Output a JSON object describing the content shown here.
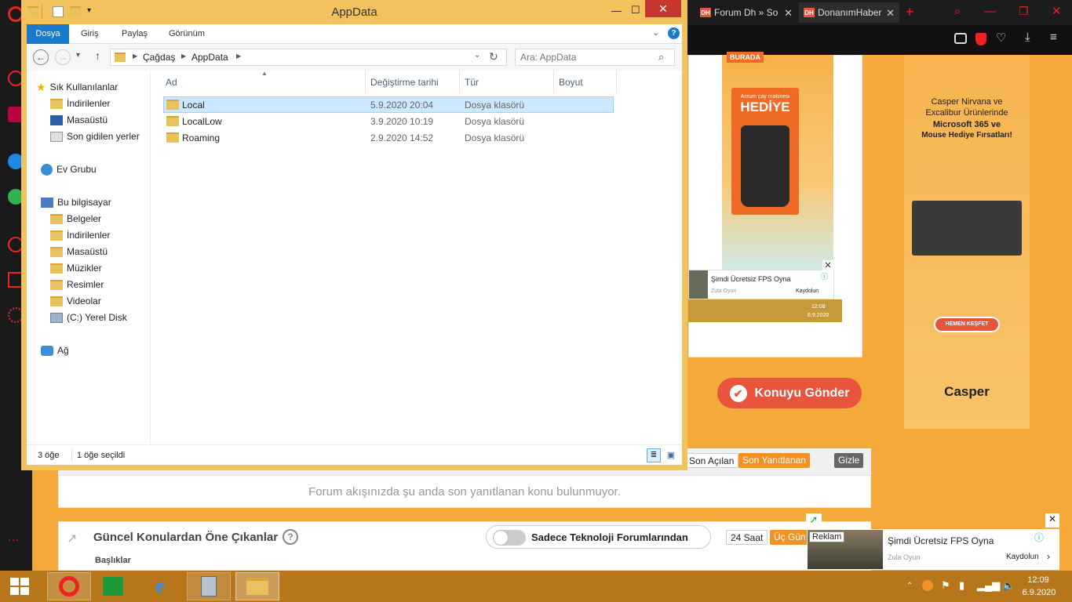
{
  "explorer": {
    "title": "AppData",
    "ribbon_tabs": [
      "Dosya",
      "Giriş",
      "Paylaş",
      "Görünüm"
    ],
    "breadcrumb": [
      "Çağdaş",
      "AppData"
    ],
    "search_placeholder": "Ara: AppData",
    "nav": {
      "favorites": {
        "label": "Sık Kullanılanlar",
        "items": [
          "İndirilenler",
          "Masaüstü",
          "Son gidilen yerler"
        ]
      },
      "homegroup": "Ev Grubu",
      "computer": {
        "label": "Bu bilgisayar",
        "items": [
          "Belgeler",
          "İndirilenler",
          "Masaüstü",
          "Müzikler",
          "Resimler",
          "Videolar",
          "(C:) Yerel Disk"
        ]
      },
      "network": "Ağ"
    },
    "columns": [
      "Ad",
      "Değiştirme tarihi",
      "Tür",
      "Boyut"
    ],
    "files": [
      {
        "name": "Local",
        "date": "5.9.2020 20:04",
        "type": "Dosya klasörü",
        "size": ""
      },
      {
        "name": "LocalLow",
        "date": "3.9.2020 10:19",
        "type": "Dosya klasörü",
        "size": ""
      },
      {
        "name": "Roaming",
        "date": "2.9.2020 14:52",
        "type": "Dosya klasörü",
        "size": ""
      }
    ],
    "status": {
      "count": "3 öğe",
      "selected": "1 öğe seçildi"
    }
  },
  "browser": {
    "tabs": [
      {
        "favicon": "DH",
        "label": "Forum Dh » So"
      },
      {
        "favicon": "DH",
        "label": "DonanımHaber"
      }
    ]
  },
  "page": {
    "ad_mid": {
      "badge": "BURADA",
      "tagline": "Arzum çay makinesi",
      "headline": "HEDİYE",
      "sub_ad_title": "Şimdi Ücretsiz FPS Oyna",
      "sub_ad_source": "Zula Oyun",
      "sub_ad_cta": "Kaydolun",
      "inner_time": "12:08",
      "inner_date": "6.9.2020"
    },
    "send_button": "Konuyu Gönder",
    "right_ad": {
      "line1": "Casper Nirvana ve",
      "line2": "Excalibur Ürünlerinde",
      "line3": "Microsoft 365 ve",
      "line4": "Mouse Hediye Fırsatları!",
      "cta": "HEMEN KEŞFET",
      "brand": "Casper"
    },
    "filters": {
      "opened": "Son Açılan",
      "replied": "Son Yanıtlanan",
      "hide": "Gizle"
    },
    "empty_message": "Forum akışınızda şu anda son yanıtlanan konu bulunmuyor.",
    "trending": {
      "title": "Güncel Konulardan Öne Çıkanlar",
      "toggle_label": "Sadece Teknoloji Forumlarından",
      "time_filter": "24 Saat",
      "top_filter": "Üç Gün",
      "column": "Başlıklar"
    },
    "bottom_ad": {
      "tag": "Reklam",
      "title": "Şimdi Ücretsiz FPS Oyna",
      "source": "Zula Oyun",
      "cta": "Kaydolun"
    }
  },
  "taskbar": {
    "time": "12:09",
    "date": "6.9.2020"
  },
  "colors": {
    "accent": "#e8553c",
    "selection": "#cce8ff",
    "explorer_frame": "#f2c25c",
    "taskbar": "#b8761a"
  }
}
